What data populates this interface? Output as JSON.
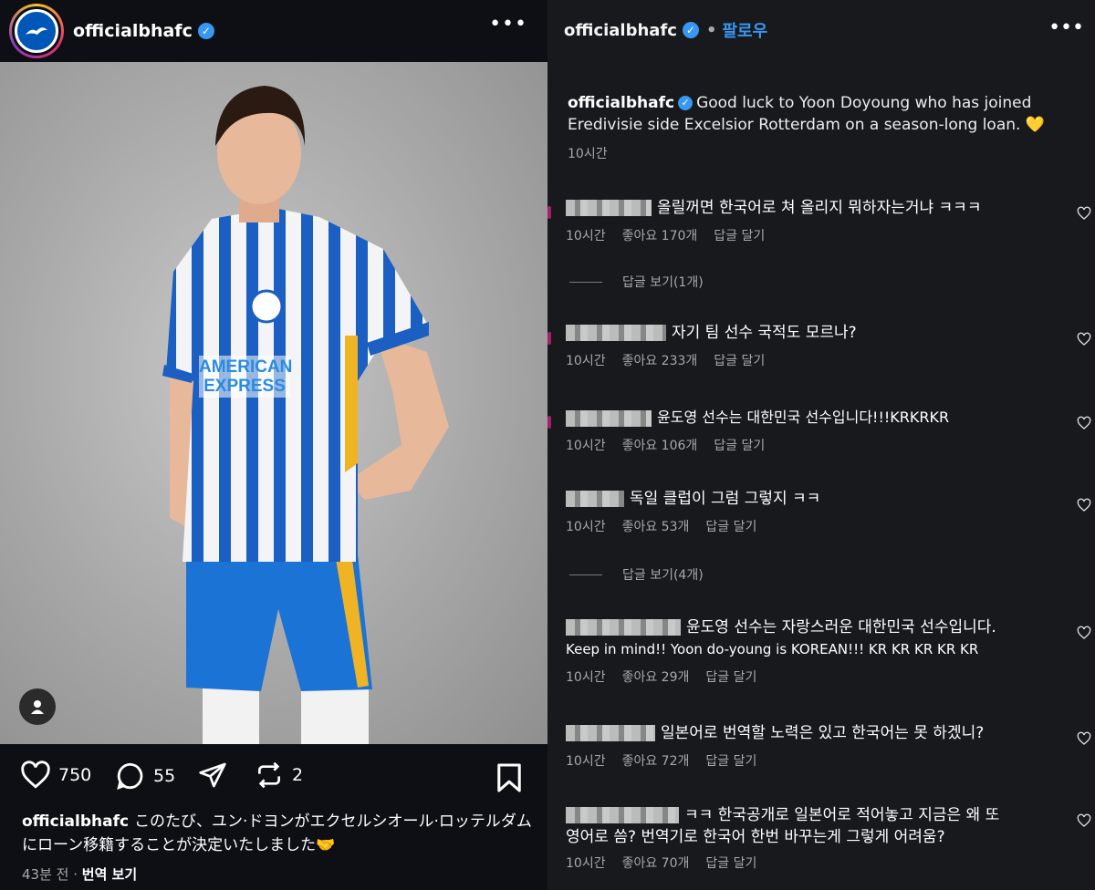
{
  "left": {
    "username": "officialbhafc",
    "likes": "750",
    "comments": "55",
    "reposts": "2",
    "caption_user": "officialbhafc",
    "caption_text": "このたび、ユン·ドヨンがエクセルシオール·ロッテルダムにローン移籍することが決定いたしました🤝",
    "time": "43분 전",
    "translate": "번역 보기",
    "jersey_sponsor_1": "AMERICAN",
    "jersey_sponsor_2": "EXPRESS"
  },
  "right": {
    "username": "officialbhafc",
    "follow": "팔로우",
    "caption_user": "officialbhafc",
    "caption_text": "Good luck to Yoon Doyoung who has joined Eredivisie side Excelsior Rotterdam on a season-long loan. 💛",
    "caption_time": "10시간",
    "comments": [
      {
        "text": "올릴꺼면 한국어로 쳐 올리지 뭐하자는거냐 ㅋㅋㅋ",
        "time": "10시간",
        "likes": "좋아요 170개",
        "reply": "답글 달기"
      },
      {
        "text": "자기 팀 선수 국적도 모르나?",
        "time": "10시간",
        "likes": "좋아요 233개",
        "reply": "답글 달기"
      },
      {
        "text": "윤도영 선수는 대한민국 선수입니다!!!KRKRKR",
        "time": "10시간",
        "likes": "좋아요 106개",
        "reply": "답글 달기"
      },
      {
        "text": "독일 클럽이 그럼 그렇지 ㅋㅋ",
        "time": "10시간",
        "likes": "좋아요 53개",
        "reply": "답글 달기"
      },
      {
        "text": "윤도영 선수는 자랑스러운 대한민국 선수입니다.",
        "text2": "Keep in mind!! Yoon do-young is KOREAN!!! KR KR KR KR KR",
        "time": "10시간",
        "likes": "좋아요 29개",
        "reply": "답글 달기"
      },
      {
        "text": "일본어로 번역할 노력은 있고 한국어는 못 하겠니?",
        "time": "10시간",
        "likes": "좋아요 72개",
        "reply": "답글 달기"
      },
      {
        "text": "ㅋㅋ 한국공개로 일본어로 적어놓고 지금은 왜 또",
        "text2": "영어로 씀? 번역기로 한국어 한번 바꾸는게 그렇게 어려움?",
        "time": "10시간",
        "likes": "좋아요 70개",
        "reply": "답글 달기"
      }
    ],
    "view_replies_1": "답글 보기(1개)",
    "view_replies_2": "답글 보기(4개)"
  },
  "colors": {
    "accent": "#3897f0",
    "panel_left": "#0d0f14",
    "panel_right": "#17191c",
    "brighton_blue": "#0057b8"
  },
  "icons": [
    "verified-icon",
    "more-icon",
    "heart-icon",
    "comment-icon",
    "share-icon",
    "repost-icon",
    "bookmark-icon",
    "user-tag-icon"
  ]
}
